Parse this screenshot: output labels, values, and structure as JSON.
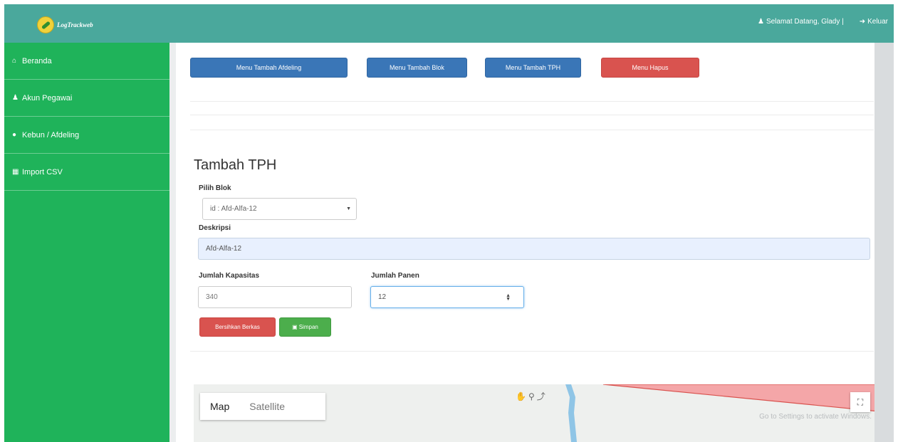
{
  "header": {
    "logo_text": "LogTrackweb",
    "welcome": "Selamat Datang, Glady |",
    "logout": "Keluar"
  },
  "sidebar": {
    "items": [
      {
        "label": "Beranda",
        "icon": "home-icon"
      },
      {
        "label": "Akun Pegawai",
        "icon": "user-icon"
      },
      {
        "label": "Kebun / Afdeling",
        "icon": "map-marker-icon"
      },
      {
        "label": "Import CSV",
        "icon": "table-icon"
      }
    ]
  },
  "toolbar": {
    "btn_afdeling": "Menu Tambah Afdeling",
    "btn_blok": "Menu Tambah Blok",
    "btn_tph": "Menu Tambah TPH",
    "btn_hapus": "Menu Hapus"
  },
  "form": {
    "title": "Tambah TPH",
    "pilih_blok_label": "Pilih Blok",
    "pilih_blok_value": "id : Afd-Alfa-12",
    "deskripsi_label": "Deskripsi",
    "deskripsi_value": "Afd-Alfa-12",
    "kapasitas_label": "Jumlah Kapasitas",
    "kapasitas_value": "340",
    "panen_label": "Jumlah Panen",
    "panen_value": "12",
    "reset_label": "Bersihkan Berkas",
    "save_label": "Simpan"
  },
  "map": {
    "tab_map": "Map",
    "tab_satellite": "Satellite",
    "watermark": "Go to Settings to activate Windows."
  },
  "colors": {
    "topbar": "#4aa89c",
    "sidebar": "#1fb35a",
    "primary": "#3a76b7",
    "danger": "#d9534f",
    "success": "#4cae4c"
  }
}
